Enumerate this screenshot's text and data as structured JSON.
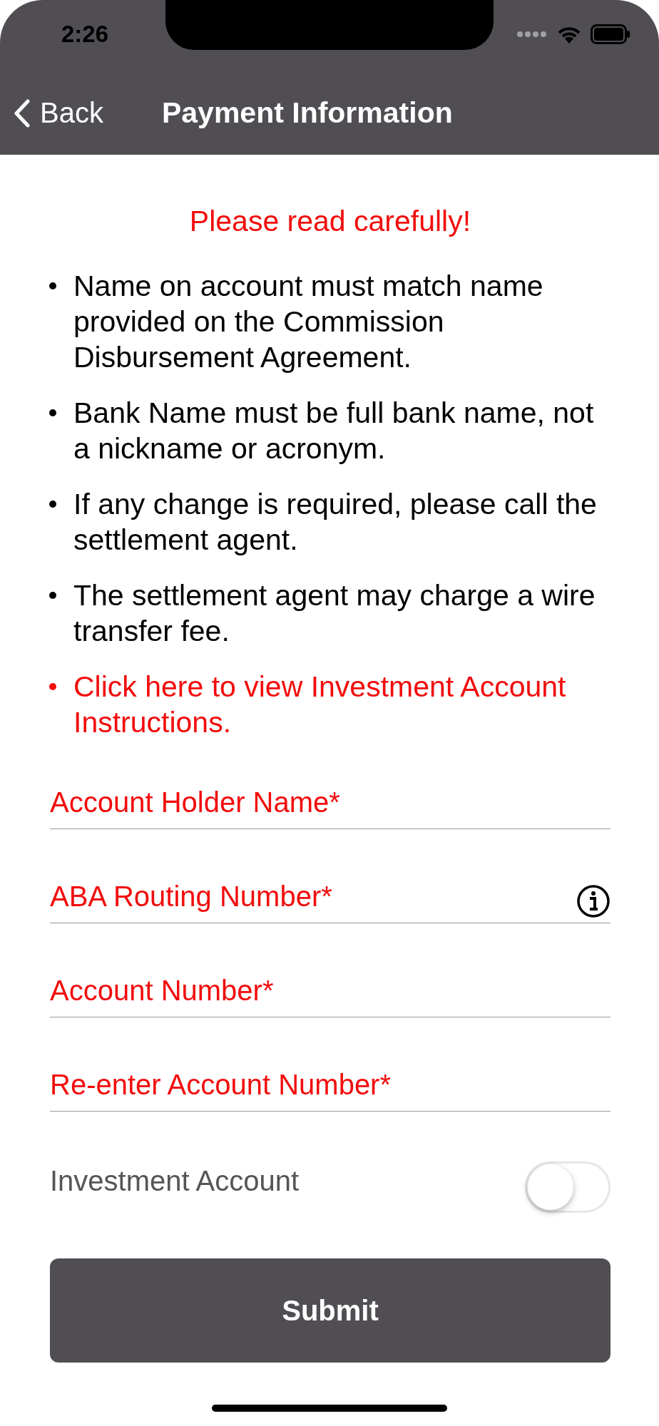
{
  "status_bar": {
    "time": "2:26"
  },
  "nav": {
    "back_label": "Back",
    "title": "Payment Information"
  },
  "notice": "Please read carefully!",
  "instructions": [
    {
      "kind": "text",
      "text": "Name on account must match name provided on the Commission Disbursement Agreement."
    },
    {
      "kind": "text",
      "text": "Bank Name must be full bank name, not a nickname or acronym."
    },
    {
      "kind": "text",
      "text": "If any change is required, please call the settlement agent."
    },
    {
      "kind": "text",
      "text": "The settlement agent may charge a wire transfer fee."
    },
    {
      "kind": "link",
      "text": "Click here to view Investment Account Instructions."
    }
  ],
  "fields": [
    {
      "placeholder": "Account Holder Name*",
      "info": false
    },
    {
      "placeholder": "ABA Routing Number*",
      "info": true
    },
    {
      "placeholder": "Account Number*",
      "info": false
    },
    {
      "placeholder": "Re-enter Account Number*",
      "info": false
    }
  ],
  "toggle": {
    "label": "Investment Account",
    "on": false
  },
  "submit": "Submit"
}
